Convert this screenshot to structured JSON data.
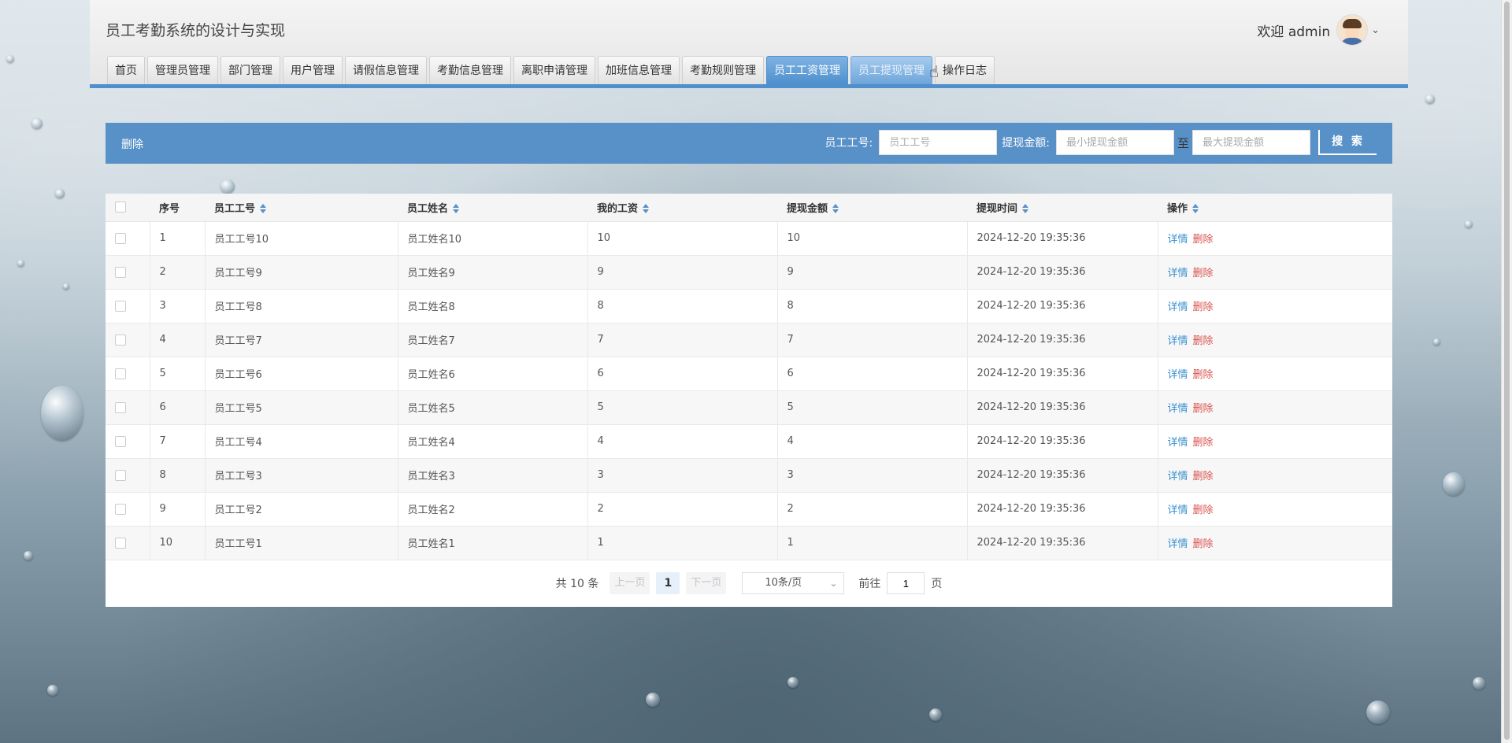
{
  "header": {
    "site_title": "员工考勤系统的设计与实现",
    "welcome": "欢迎 admin"
  },
  "nav": {
    "tabs": [
      {
        "label": "首页"
      },
      {
        "label": "管理员管理"
      },
      {
        "label": "部门管理"
      },
      {
        "label": "用户管理"
      },
      {
        "label": "请假信息管理"
      },
      {
        "label": "考勤信息管理"
      },
      {
        "label": "离职申请管理"
      },
      {
        "label": "加班信息管理"
      },
      {
        "label": "考勤规则管理"
      },
      {
        "label": "员工工资管理"
      },
      {
        "label": "员工提现管理"
      },
      {
        "label": "操作日志"
      }
    ]
  },
  "toolbar": {
    "delete_label": "删除",
    "filter_emp_label": "员工工号:",
    "filter_emp_placeholder": "员工工号",
    "filter_amount_label": "提现金额:",
    "filter_min_placeholder": "最小提现金额",
    "to_label": "至",
    "filter_max_placeholder": "最大提现金额",
    "search_label": "搜 索"
  },
  "table": {
    "headers": {
      "seq": "序号",
      "emp_no": "员工工号",
      "emp_name": "员工姓名",
      "salary": "我的工资",
      "amount": "提现金额",
      "time": "提现时间",
      "ops": "操作"
    },
    "rows": [
      {
        "seq": "1",
        "emp_no": "员工工号10",
        "emp_name": "员工姓名10",
        "salary": "10",
        "amount": "10",
        "time": "2024-12-20 19:35:36"
      },
      {
        "seq": "2",
        "emp_no": "员工工号9",
        "emp_name": "员工姓名9",
        "salary": "9",
        "amount": "9",
        "time": "2024-12-20 19:35:36"
      },
      {
        "seq": "3",
        "emp_no": "员工工号8",
        "emp_name": "员工姓名8",
        "salary": "8",
        "amount": "8",
        "time": "2024-12-20 19:35:36"
      },
      {
        "seq": "4",
        "emp_no": "员工工号7",
        "emp_name": "员工姓名7",
        "salary": "7",
        "amount": "7",
        "time": "2024-12-20 19:35:36"
      },
      {
        "seq": "5",
        "emp_no": "员工工号6",
        "emp_name": "员工姓名6",
        "salary": "6",
        "amount": "6",
        "time": "2024-12-20 19:35:36"
      },
      {
        "seq": "6",
        "emp_no": "员工工号5",
        "emp_name": "员工姓名5",
        "salary": "5",
        "amount": "5",
        "time": "2024-12-20 19:35:36"
      },
      {
        "seq": "7",
        "emp_no": "员工工号4",
        "emp_name": "员工姓名4",
        "salary": "4",
        "amount": "4",
        "time": "2024-12-20 19:35:36"
      },
      {
        "seq": "8",
        "emp_no": "员工工号3",
        "emp_name": "员工姓名3",
        "salary": "3",
        "amount": "3",
        "time": "2024-12-20 19:35:36"
      },
      {
        "seq": "9",
        "emp_no": "员工工号2",
        "emp_name": "员工姓名2",
        "salary": "2",
        "amount": "2",
        "time": "2024-12-20 19:35:36"
      },
      {
        "seq": "10",
        "emp_no": "员工工号1",
        "emp_name": "员工姓名1",
        "salary": "1",
        "amount": "1",
        "time": "2024-12-20 19:35:36"
      }
    ],
    "detail_label": "详情",
    "delete_label": "删除"
  },
  "pager": {
    "total": "共 10 条",
    "prev": "上一页",
    "current": "1",
    "next": "下一页",
    "page_size": "10条/页",
    "goto_prefix": "前往",
    "goto_value": "1",
    "goto_suffix": "页"
  },
  "colors": {
    "accent": "#5890c8",
    "detail_link": "#3a8fd0",
    "delete_link": "#d9534f"
  }
}
